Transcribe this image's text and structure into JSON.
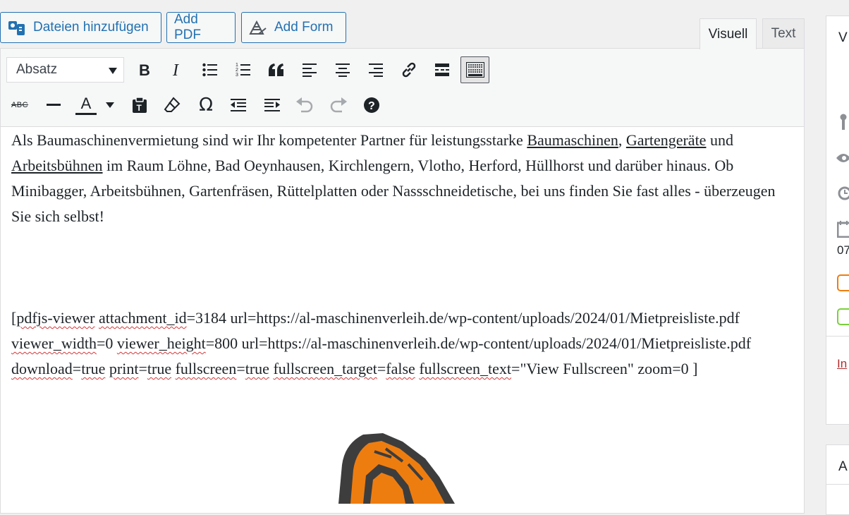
{
  "media_buttons": {
    "add_media": "Dateien hinzufügen",
    "add_pdf": "Add PDF",
    "add_form": "Add Form"
  },
  "tabs": {
    "visual": "Visuell",
    "text": "Text"
  },
  "toolbar": {
    "format_select": "Absatz",
    "row1_icons": [
      "bold-icon",
      "italic-icon",
      "bulleted-list-icon",
      "numbered-list-icon",
      "blockquote-icon",
      "align-left-icon",
      "align-center-icon",
      "align-right-icon",
      "insert-link-icon",
      "read-more-icon",
      "toolbar-toggle-icon"
    ],
    "row2_icons": [
      "strikethrough-icon",
      "horizontal-line-icon",
      "text-color-icon",
      "paste-as-text-icon",
      "clear-formatting-icon",
      "special-character-icon",
      "outdent-icon",
      "indent-icon",
      "undo-icon",
      "redo-icon",
      "help-icon"
    ],
    "strike_label": "ABC",
    "text_color_label": "A",
    "omega": "Ω"
  },
  "content": {
    "p1_before": "Als Baumaschinenvermietung sind wir Ihr kompetenter Partner für leistungsstarke ",
    "link_baumaschinen": "Baumaschinen",
    "comma": ",",
    "link_gartengeraete": "Gartengeräte",
    "und": " und ",
    "link_arbeitsbuehnen": "Arbeitsbühnen",
    "p1_after": " im Raum Löhne, Bad Oeynhausen, Kirchlengern, Vlotho, Herford, Hüllhorst und darüber hinaus. Ob Minibagger, Arbeitsbühnen, Gartenfräsen, Rüttelplatten oder Nassschneidetische, bei uns finden Sie fast alles - überzeugen Sie sich selbst!",
    "sc": {
      "open": "[",
      "w_pdfjs": "pdfjs-viewer",
      "w_attach": "attachment_id",
      "t1": "=3184 url=https://al-maschinenverleih.de/wp-content/uploads/2024/01/Mietpreisliste.pdf ",
      "w_viewer_width": "viewer_width",
      "t2": "=0 ",
      "w_viewer_height": "viewer_height",
      "t3": "=800 url=https://al-maschinenverleih.de/wp-content/uploads/2024/01/Mietpreisliste.pdf ",
      "w_download": "download",
      "t4": "=",
      "w_true1": "true",
      "t5": " ",
      "w_print": "print",
      "t6": "=",
      "w_true2": "true",
      "t7": " ",
      "w_fullscreen": "fullscreen",
      "t8": "=",
      "w_true3": "true",
      "t9": " ",
      "w_fs_target": "fullscreen_target",
      "t10": "=",
      "w_false": "false",
      "t11": " ",
      "w_fs_text": "fullscreen_text",
      "t12": "=\"View Fullscreen\" zoom=0 ]"
    }
  },
  "sidebar": {
    "box1_title": "V",
    "date_fragment": "07",
    "link_fragment": "In",
    "box2_title": "A"
  }
}
